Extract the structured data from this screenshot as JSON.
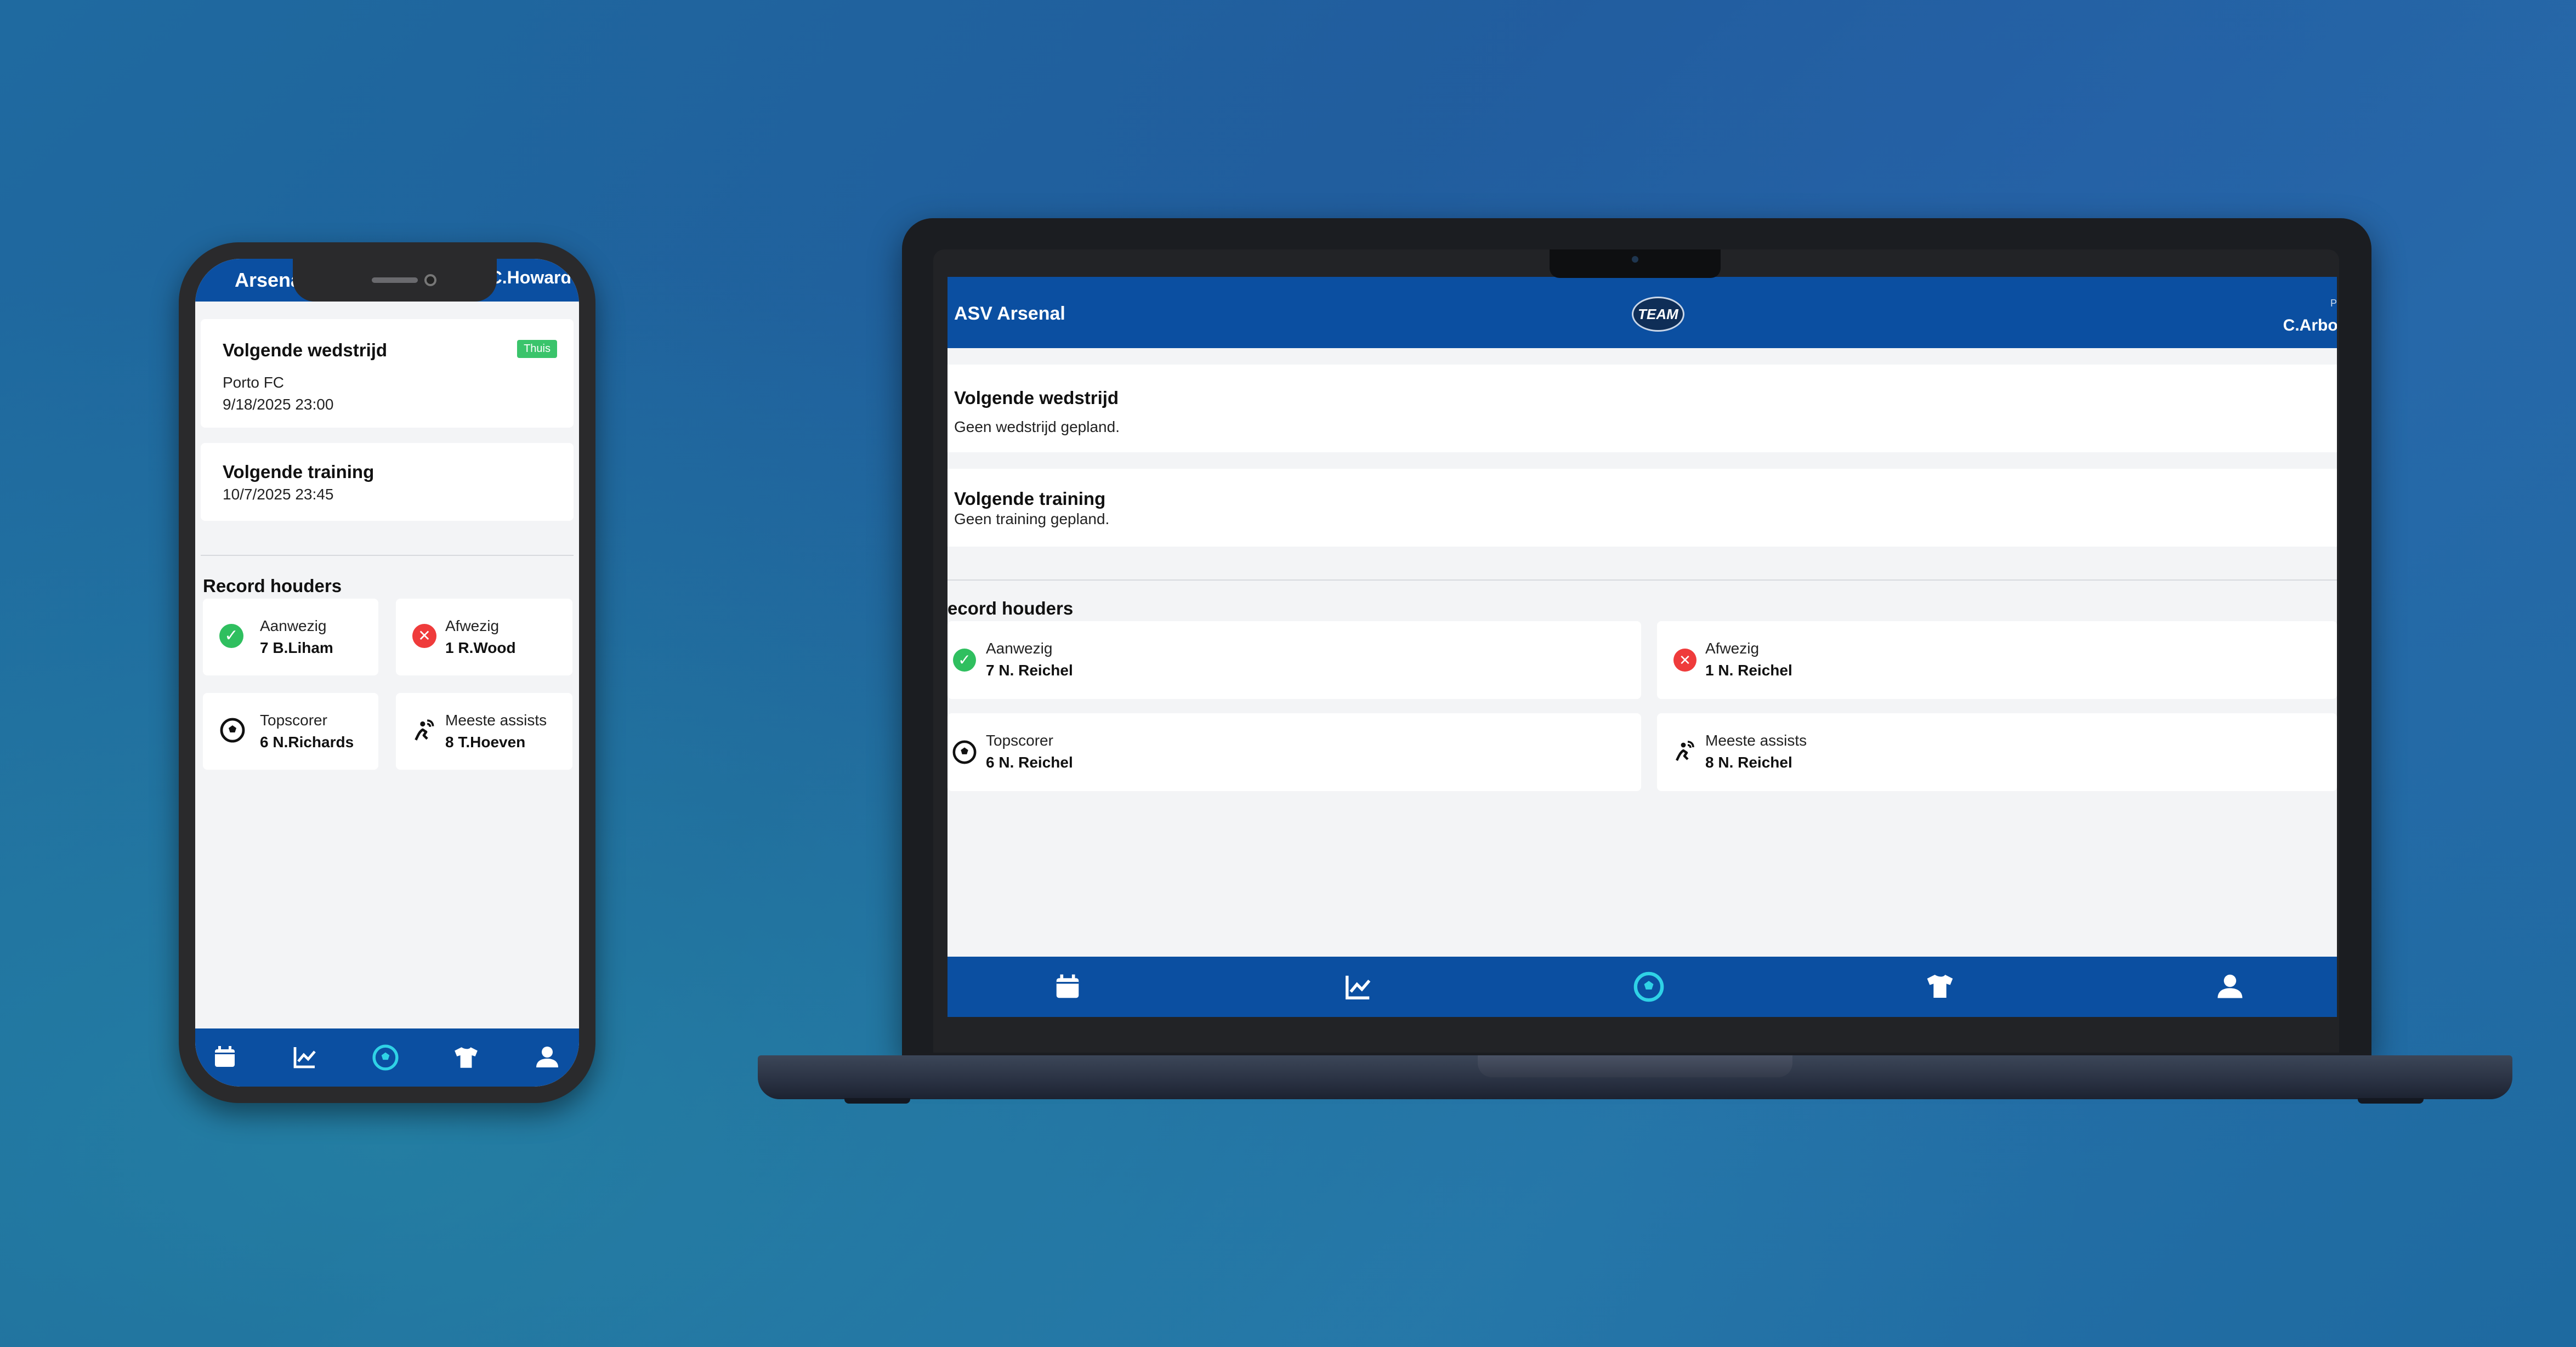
{
  "colors": {
    "brand_blue": "#0b4fa1",
    "present_green": "#2fbf5f",
    "absent_red": "#ef3b3b",
    "active_nav": "#2fd2e6",
    "badge_green": "#3ac46b"
  },
  "phone": {
    "header": {
      "team": "Arsenal",
      "user": "C.Howard"
    },
    "next_match": {
      "title": "Volgende wedstrijd",
      "badge": "Thuis",
      "opponent": "Porto FC",
      "datetime": "9/18/2025  23:00"
    },
    "next_training": {
      "title": "Volgende training",
      "datetime": "10/7/2025 23:45"
    },
    "records": {
      "title": "Record houders",
      "items": [
        {
          "label": "Aanwezig",
          "value": "7 B.Liham",
          "icon": "check-icon"
        },
        {
          "label": "Afwezig",
          "value": "1 R.Wood",
          "icon": "x-icon"
        },
        {
          "label": "Topscorer",
          "value": "6 N.Richards",
          "icon": "soccer-ball-icon"
        },
        {
          "label": "Meeste assists",
          "value": "8 T.Hoeven",
          "icon": "assist-icon"
        }
      ]
    },
    "nav": [
      "calendar-icon",
      "chart-icon",
      "soccer-ball-icon",
      "shirt-icon",
      "user-icon"
    ],
    "active_nav": "soccer-ball-icon"
  },
  "laptop": {
    "header": {
      "team": "ASV Arsenal",
      "logo_text": "TEAM",
      "user": "C.Arbol",
      "role_hint": "P"
    },
    "next_match": {
      "title": "Volgende wedstrijd",
      "text": "Geen wedstrijd gepland."
    },
    "next_training": {
      "title": "Volgende training",
      "text": "Geen training gepland."
    },
    "records": {
      "title": "ecord houders",
      "items": [
        {
          "label": "Aanwezig",
          "value": "7 N. Reichel",
          "icon": "check-icon"
        },
        {
          "label": "Afwezig",
          "value": "1 N. Reichel",
          "icon": "x-icon"
        },
        {
          "label": "Topscorer",
          "value": "6 N. Reichel",
          "icon": "soccer-ball-icon"
        },
        {
          "label": "Meeste assists",
          "value": "8 N. Reichel",
          "icon": "assist-icon"
        }
      ]
    },
    "nav": [
      "calendar-icon",
      "chart-icon",
      "soccer-ball-icon",
      "shirt-icon",
      "user-icon"
    ],
    "active_nav": "soccer-ball-icon"
  }
}
